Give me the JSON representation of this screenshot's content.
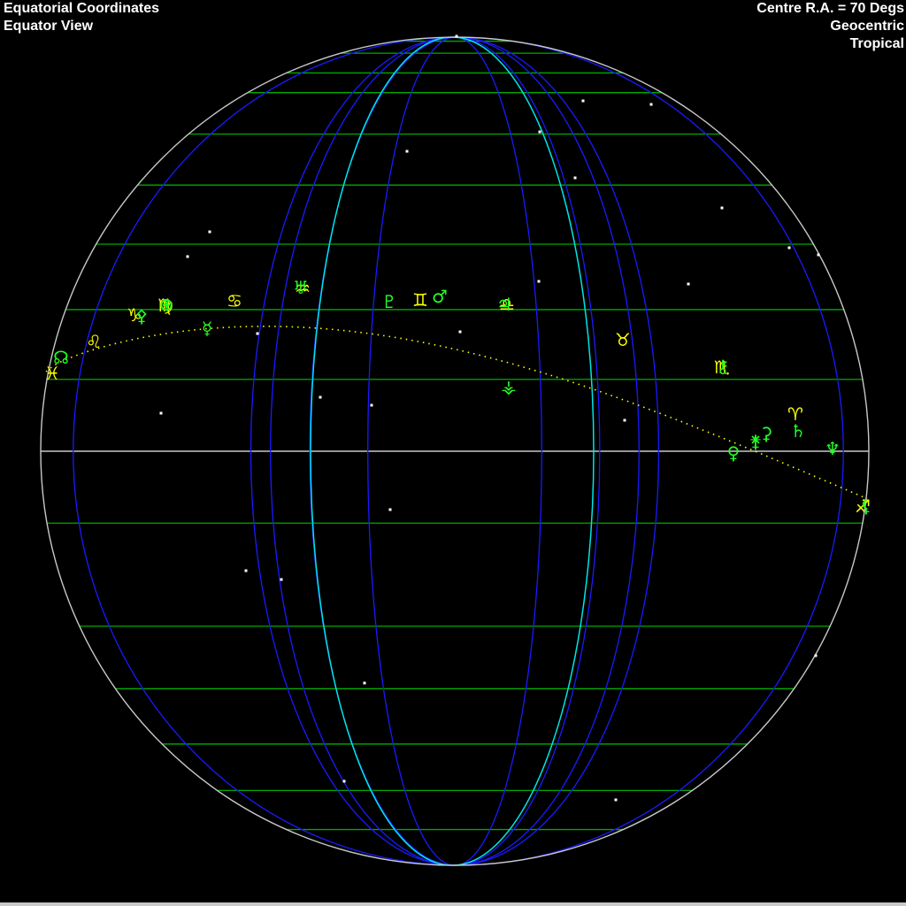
{
  "header": {
    "coordinate_system": "Equatorial Coordinates",
    "view_mode": "Equator View",
    "centre_ra": "Centre R.A. = 70 Degs",
    "perspective": "Geocentric",
    "zodiac": "Tropical"
  },
  "colors": {
    "background": "#000000",
    "meridian": "#1a1aff",
    "central_meridian": "#00e5e5",
    "parallel": "#00aa00",
    "equator": "#c8c8c8",
    "limb": "#c8c8c8",
    "ecliptic": "#ffff00",
    "zodiac_glyph": "#ffff00",
    "planet_glyph": "#22ff22",
    "star": "#ffffff",
    "text": "#ffffff"
  },
  "zodiac_signs": [
    {
      "name": "aries",
      "glyph": "♈"
    },
    {
      "name": "taurus",
      "glyph": "♉"
    },
    {
      "name": "gemini",
      "glyph": "♊"
    },
    {
      "name": "cancer",
      "glyph": "♋"
    },
    {
      "name": "leo",
      "glyph": "♌"
    },
    {
      "name": "virgo",
      "glyph": "♍"
    },
    {
      "name": "libra",
      "glyph": "♎"
    },
    {
      "name": "scorpio",
      "glyph": "♏"
    },
    {
      "name": "sagittarius",
      "glyph": "♐"
    },
    {
      "name": "capricorn",
      "glyph": "♑"
    },
    {
      "name": "aquarius",
      "glyph": "♒"
    },
    {
      "name": "pisces",
      "glyph": "♓"
    }
  ],
  "bodies": [
    {
      "name": "mars",
      "glyph": "♂"
    },
    {
      "name": "venus",
      "glyph": "♀"
    },
    {
      "name": "mercury",
      "glyph": "☿"
    },
    {
      "name": "saturn",
      "glyph": "♄"
    },
    {
      "name": "uranus",
      "glyph": "♅"
    },
    {
      "name": "neptune",
      "glyph": "♆"
    },
    {
      "name": "pluto",
      "glyph": "♇"
    },
    {
      "name": "chiron",
      "glyph": "⚷"
    },
    {
      "name": "ceres",
      "glyph": "⚳"
    },
    {
      "name": "juno",
      "glyph": "⚵"
    },
    {
      "name": "vesta",
      "glyph": "⚶"
    },
    {
      "name": "north-node",
      "glyph": "☊"
    },
    {
      "name": "fortune",
      "glyph": "⊕"
    },
    {
      "name": "lilith",
      "glyph": "⚸"
    },
    {
      "name": "asteroid",
      "glyph": "⚴"
    },
    {
      "name": "jupiter",
      "glyph": "♃"
    }
  ]
}
